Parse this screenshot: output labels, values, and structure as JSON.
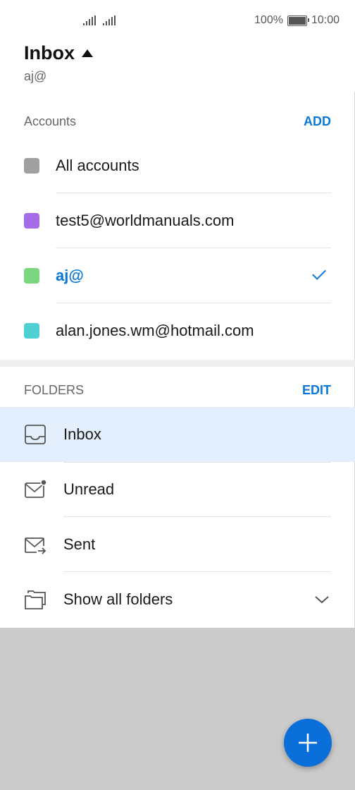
{
  "status_bar": {
    "battery_percent": "100%",
    "time": "10:00"
  },
  "header": {
    "title": "Inbox",
    "subtitle": "aj@"
  },
  "accounts": {
    "heading": "Accounts",
    "add_label": "ADD",
    "items": [
      {
        "label": "All accounts",
        "color": "#a0a0a0",
        "active": false
      },
      {
        "label": "test5@worldmanuals.com",
        "color": "#a56be8",
        "active": false
      },
      {
        "label": "aj@",
        "color": "#7ad67f",
        "active": true
      },
      {
        "label": "alan.jones.wm@hotmail.com",
        "color": "#4fd1d3",
        "active": false
      }
    ]
  },
  "folders": {
    "heading": "FOLDERS",
    "edit_label": "EDIT",
    "items": [
      {
        "label": "Inbox",
        "icon": "inbox-icon",
        "selected": true
      },
      {
        "label": "Unread",
        "icon": "unread-mail-icon",
        "selected": false
      },
      {
        "label": "Sent",
        "icon": "sent-mail-icon",
        "selected": false
      },
      {
        "label": "Show all folders",
        "icon": "folders-icon",
        "selected": false
      }
    ]
  },
  "fab": {
    "icon": "plus-icon"
  },
  "colors": {
    "accent": "#0a78d6",
    "selected_row": "#e3effc",
    "scrim": "#cbcbcb"
  }
}
